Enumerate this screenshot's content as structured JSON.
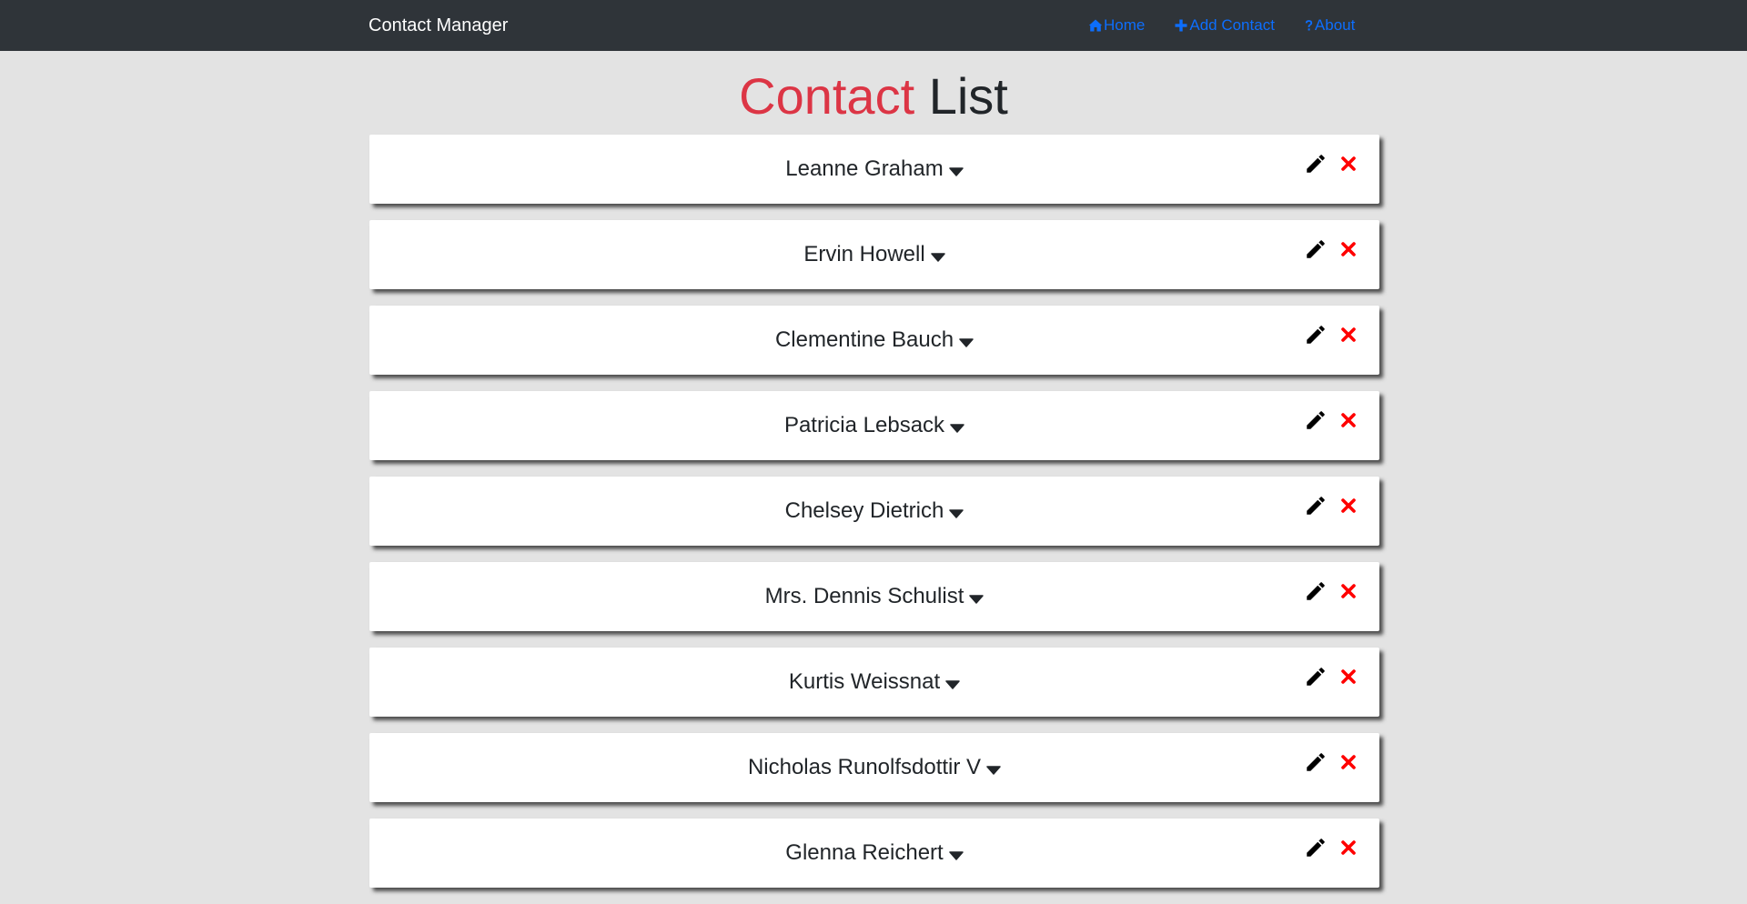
{
  "navbar": {
    "brand": "Contact Manager",
    "links": [
      {
        "label": "Home",
        "icon": "home-icon"
      },
      {
        "label": "Add Contact",
        "icon": "plus-icon"
      },
      {
        "label": "About",
        "icon": "question-icon"
      }
    ]
  },
  "title": {
    "accent": "Contact",
    "rest": "List"
  },
  "contacts": [
    {
      "name": "Leanne Graham"
    },
    {
      "name": "Ervin Howell"
    },
    {
      "name": "Clementine Bauch"
    },
    {
      "name": "Patricia Lebsack"
    },
    {
      "name": "Chelsey Dietrich"
    },
    {
      "name": "Mrs. Dennis Schulist"
    },
    {
      "name": "Kurtis Weissnat"
    },
    {
      "name": "Nicholas Runolfsdottir V"
    },
    {
      "name": "Glenna Reichert"
    }
  ],
  "colors": {
    "navbar_bg": "#2f3439",
    "link": "#0d6efd",
    "accent": "#dc3545",
    "delete": "#ff0000",
    "page_bg": "#e3e3e3"
  }
}
